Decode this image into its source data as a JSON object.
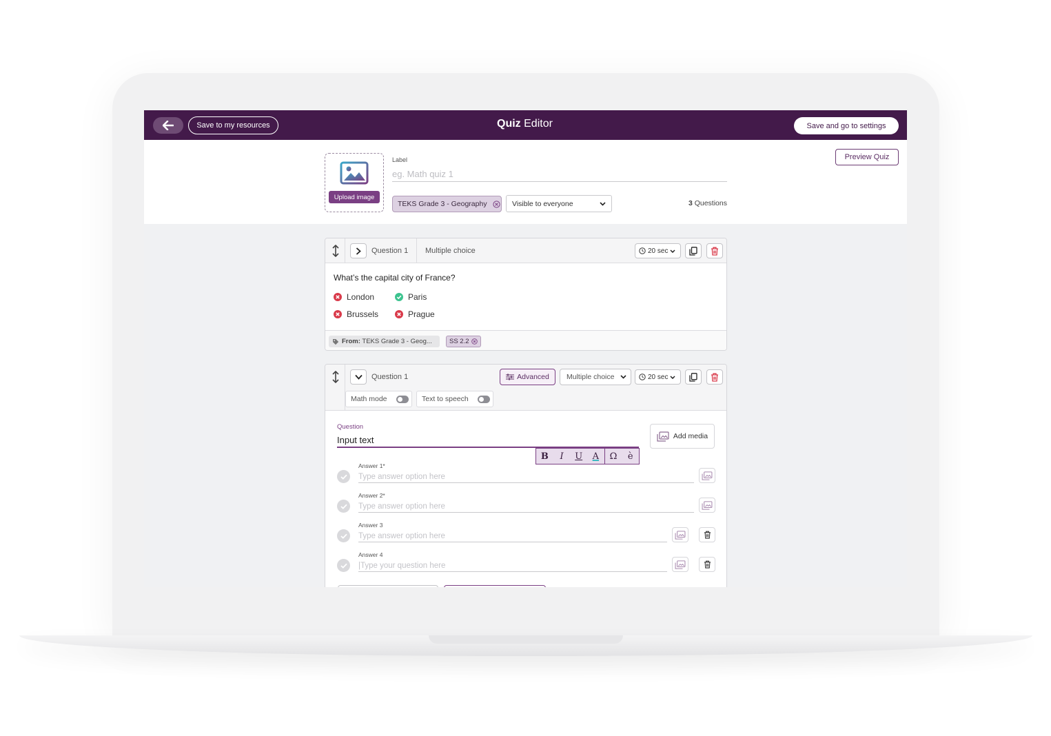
{
  "topbar": {
    "save_resources_label": "Save to my resources",
    "logo_bold": "Quiz",
    "logo_rest": " Editor",
    "save_settings_label": "Save and go to settings"
  },
  "header": {
    "preview_label": "Preview Quiz",
    "upload_label": "Upload image",
    "label_caption": "Label",
    "label_placeholder": "eg. Math quiz 1",
    "tag_chip": "TEKS Grade 3 - Geography",
    "visibility_selected": "Visible to everyone",
    "question_count": "3",
    "question_count_suffix": " Questions"
  },
  "question1": {
    "label": "Question 1",
    "type": "Multiple choice",
    "time": "20 sec",
    "text": "What’s the capital city of France?",
    "answers": [
      {
        "text": "London",
        "correct": false
      },
      {
        "text": "Paris",
        "correct": true
      },
      {
        "text": "Brussels",
        "correct": false
      },
      {
        "text": "Prague",
        "correct": false
      }
    ],
    "from_prefix": "From:",
    "from_value": " TEKS Grade 3 - Geog...",
    "standard_chip": "SS 2.2"
  },
  "question2": {
    "label": "Question 1",
    "advanced_label": "Advanced",
    "type_selected": "Multiple choice",
    "time": "20 sec",
    "math_mode_label": "Math mode",
    "tts_label": "Text to speech",
    "question_caption": "Question",
    "question_value": "Input text",
    "add_media_label": "Add media",
    "format": {
      "bold": "B",
      "italic": "I",
      "underline": "U",
      "color": "A",
      "omega": "Ω",
      "accent": "è"
    },
    "answers": [
      {
        "caption": "Answer 1*",
        "placeholder": "Type answer option here"
      },
      {
        "caption": "Answer 2*",
        "placeholder": "Type answer option here"
      },
      {
        "caption": "Answer 3",
        "placeholder": "Type answer option here"
      },
      {
        "caption": "Answer 4",
        "placeholder": "|Type your question here"
      }
    ]
  },
  "colors": {
    "brand": "#431a4a",
    "accent": "#7a3f83",
    "correct": "#3cc38f",
    "wrong": "#d93a4a"
  }
}
